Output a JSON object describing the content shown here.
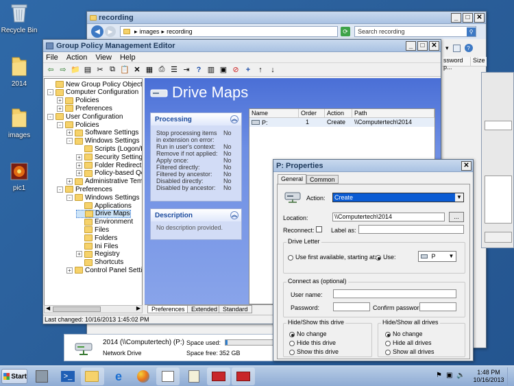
{
  "desktop": {
    "icons": [
      {
        "label": "Recycle Bin",
        "glyph": "recycle-bin-icon"
      },
      {
        "label": "2014",
        "glyph": "folder-icon"
      },
      {
        "label": "images",
        "glyph": "folder-icon"
      },
      {
        "label": "pic1",
        "glyph": "image-icon"
      }
    ]
  },
  "explorer": {
    "title": "recording",
    "breadcrumb": [
      "images",
      "recording"
    ],
    "search_placeholder": "Search recording",
    "col_password": "ssword p...",
    "col_size": "Size"
  },
  "gpme": {
    "title": "Group Policy Management Editor",
    "menu": [
      "File",
      "Action",
      "View",
      "Help"
    ],
    "tree": [
      {
        "label": "New Group Policy Object [COMPUT",
        "level": 0,
        "toggle": ""
      },
      {
        "label": "Computer Configuration",
        "level": 0,
        "toggle": "-"
      },
      {
        "label": "Policies",
        "level": 1,
        "toggle": "+"
      },
      {
        "label": "Preferences",
        "level": 1,
        "toggle": "+"
      },
      {
        "label": "User Configuration",
        "level": 0,
        "toggle": "-"
      },
      {
        "label": "Policies",
        "level": 1,
        "toggle": "-"
      },
      {
        "label": "Software Settings",
        "level": 2,
        "toggle": "+"
      },
      {
        "label": "Windows Settings",
        "level": 2,
        "toggle": "-"
      },
      {
        "label": "Scripts (Logon/Logo",
        "level": 3,
        "toggle": ""
      },
      {
        "label": "Security Settings",
        "level": 3,
        "toggle": "+"
      },
      {
        "label": "Folder Redirection",
        "level": 3,
        "toggle": "+"
      },
      {
        "label": "Policy-based QoS",
        "level": 3,
        "toggle": "+"
      },
      {
        "label": "Administrative Templat",
        "level": 2,
        "toggle": "+"
      },
      {
        "label": "Preferences",
        "level": 1,
        "toggle": "-"
      },
      {
        "label": "Windows Settings",
        "level": 2,
        "toggle": "-"
      },
      {
        "label": "Applications",
        "level": 3,
        "toggle": ""
      },
      {
        "label": "Drive Maps",
        "level": 3,
        "toggle": "",
        "selected": true
      },
      {
        "label": "Environment",
        "level": 3,
        "toggle": ""
      },
      {
        "label": "Files",
        "level": 3,
        "toggle": ""
      },
      {
        "label": "Folders",
        "level": 3,
        "toggle": ""
      },
      {
        "label": "Ini Files",
        "level": 3,
        "toggle": ""
      },
      {
        "label": "Registry",
        "level": 3,
        "toggle": "+"
      },
      {
        "label": "Shortcuts",
        "level": 3,
        "toggle": ""
      },
      {
        "label": "Control Panel Settings",
        "level": 2,
        "toggle": "+"
      }
    ],
    "heading": "Drive Maps",
    "processing": {
      "title": "Processing",
      "rows": [
        {
          "k": "Stop processing items in extension on error:",
          "v": "No"
        },
        {
          "k": "Run in user's context:",
          "v": "No"
        },
        {
          "k": "Remove if not applied:",
          "v": "No"
        },
        {
          "k": "Apply once:",
          "v": "No"
        },
        {
          "k": "Filtered directly:",
          "v": "No"
        },
        {
          "k": "Filtered by ancestor:",
          "v": "No"
        },
        {
          "k": "Disabled directly:",
          "v": "No"
        },
        {
          "k": "Disabled by ancestor:",
          "v": "No"
        }
      ]
    },
    "description": {
      "title": "Description",
      "text": "No description provided."
    },
    "columns": [
      "Name",
      "Order",
      "Action",
      "Path"
    ],
    "rows": [
      {
        "name": "P:",
        "order": "1",
        "action": "Create",
        "path": "\\\\Computertech\\2014"
      }
    ],
    "tabs": [
      "Preferences",
      "Extended",
      "Standard"
    ],
    "status": "Last changed: 10/16/2013 1:45:02 PM"
  },
  "drive_info": {
    "name": "2014 (\\\\Computertech) (P:)",
    "type": "Network Drive",
    "space_used_label": "Space used:",
    "space_free_label": "Space free:",
    "space_free": "352 GB"
  },
  "props": {
    "title": "P: Properties",
    "tabs": [
      "General",
      "Common"
    ],
    "action_label": "Action:",
    "action_value": "Create",
    "location_label": "Location:",
    "location_value": "\\\\Computertech\\2014",
    "browse_label": "...",
    "reconnect_label": "Reconnect:",
    "labelas_label": "Label as:",
    "drive_letter": {
      "title": "Drive Letter",
      "first_available": "Use first available, starting at:",
      "use": "Use:",
      "letter": "P"
    },
    "connect_as": {
      "title": "Connect as (optional)",
      "username": "User name:",
      "password": "Password:",
      "confirm": "Confirm password:"
    },
    "hide_drive": {
      "title": "Hide/Show this drive",
      "options": [
        "No change",
        "Hide this drive",
        "Show this drive"
      ]
    },
    "hide_all": {
      "title": "Hide/Show all drives",
      "options": [
        "No change",
        "Hide all drives",
        "Show all drives"
      ]
    }
  },
  "taskbar": {
    "start": "Start",
    "time": "1:48 PM",
    "date": "10/16/2013"
  }
}
